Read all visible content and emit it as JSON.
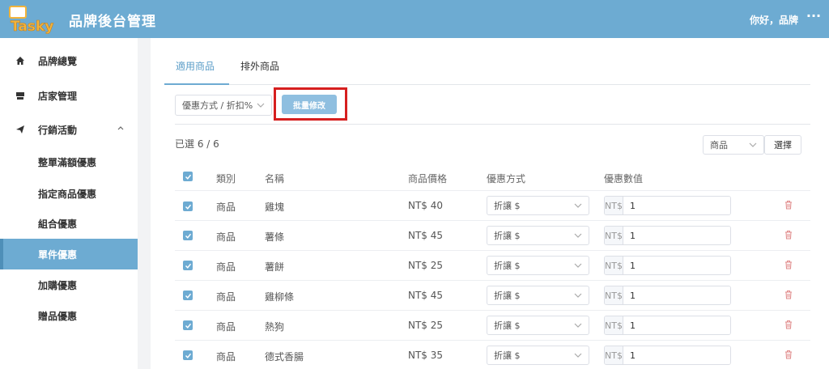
{
  "header": {
    "app_title": "品牌後台管理",
    "greeting": "你好，品牌",
    "more_label": "···",
    "bg_color": "#6dabd2"
  },
  "sidebar": {
    "items": [
      {
        "label": "品牌總覽",
        "icon": "home-icon"
      },
      {
        "label": "店家管理",
        "icon": "store-icon"
      },
      {
        "label": "行銷活動",
        "icon": "send-icon",
        "expanded": true
      }
    ],
    "sub_items": [
      {
        "label": "整單滿額優惠",
        "active": false
      },
      {
        "label": "指定商品優惠",
        "active": false
      },
      {
        "label": "組合優惠",
        "active": false
      },
      {
        "label": "單件優惠",
        "active": true
      },
      {
        "label": "加購優惠",
        "active": false
      },
      {
        "label": "贈品優惠",
        "active": false
      }
    ]
  },
  "main": {
    "tabs": [
      {
        "label": "適用商品",
        "active": true
      },
      {
        "label": "排外商品",
        "active": false
      }
    ],
    "discount_select": "優惠方式 / 折扣%",
    "batch_button": "批量修改",
    "selected_count": "已選 6 / 6",
    "type_select": "商品",
    "choose_button": "選擇",
    "columns": {
      "category": "類別",
      "name": "名稱",
      "price": "商品價格",
      "method": "優惠方式",
      "value": "優惠數值"
    },
    "rows": [
      {
        "category": "商品",
        "name": "雞塊",
        "price": "NT$ 40",
        "method": "折讓 $",
        "prefix": "NT$",
        "value": "1"
      },
      {
        "category": "商品",
        "name": "薯條",
        "price": "NT$ 45",
        "method": "折讓 $",
        "prefix": "NT$",
        "value": "1"
      },
      {
        "category": "商品",
        "name": "薯餅",
        "price": "NT$ 25",
        "method": "折讓 $",
        "prefix": "NT$",
        "value": "1"
      },
      {
        "category": "商品",
        "name": "雞柳條",
        "price": "NT$ 45",
        "method": "折讓 $",
        "prefix": "NT$",
        "value": "1"
      },
      {
        "category": "商品",
        "name": "熱狗",
        "price": "NT$ 25",
        "method": "折讓 $",
        "prefix": "NT$",
        "value": "1"
      },
      {
        "category": "商品",
        "name": "德式香腸",
        "price": "NT$ 35",
        "method": "折讓 $",
        "prefix": "NT$",
        "value": "1"
      }
    ]
  },
  "colors": {
    "accent": "#6dabd2",
    "highlight": "#d61f1f",
    "trash": "#e08a8a"
  }
}
